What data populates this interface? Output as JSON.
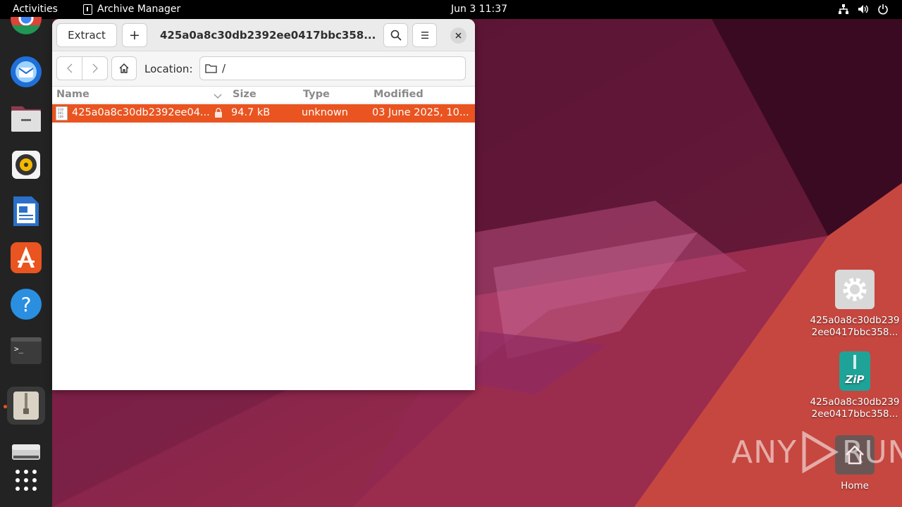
{
  "topbar": {
    "activities": "Activities",
    "app_name": "Archive Manager",
    "clock": "Jun 3  11:37",
    "tray_icons": [
      "network-icon",
      "volume-icon",
      "power-icon"
    ]
  },
  "dock": {
    "items": [
      "chrome",
      "thunderbird",
      "files",
      "rhythmbox",
      "libreoffice-writer",
      "app-center",
      "help",
      "terminal",
      "archive-manager",
      "removable-drive",
      "show-apps"
    ],
    "active": "archive-manager"
  },
  "window": {
    "extract_label": "Extract",
    "add_label": "+",
    "title": "425a0a8c30db2392ee0417bbc358...",
    "location_label": "Location:",
    "location_value": "/",
    "columns": {
      "name": "Name",
      "size": "Size",
      "type": "Type",
      "modified": "Modified"
    },
    "files": [
      {
        "name": "425a0a8c30db2392ee04...",
        "size": "94.7 kB",
        "type": "unknown",
        "modified": "03 June 2025, 10...",
        "encrypted": true
      }
    ]
  },
  "desktop": {
    "icons": [
      {
        "label_line1": "425a0a8c30db239",
        "label_line2": "2ee0417bbc358...",
        "icon": "executable-gear-icon"
      },
      {
        "label_line1": "425a0a8c30db239",
        "label_line2": "2ee0417bbc358...",
        "icon": "zip-archive-icon"
      },
      {
        "label": "Home",
        "icon": "home-folder-icon"
      }
    ]
  },
  "watermark": {
    "text_left": "ANY",
    "text_right": "RUN"
  },
  "colors": {
    "accent": "#e95420",
    "topbar": "#000000",
    "dock": "#232323"
  }
}
